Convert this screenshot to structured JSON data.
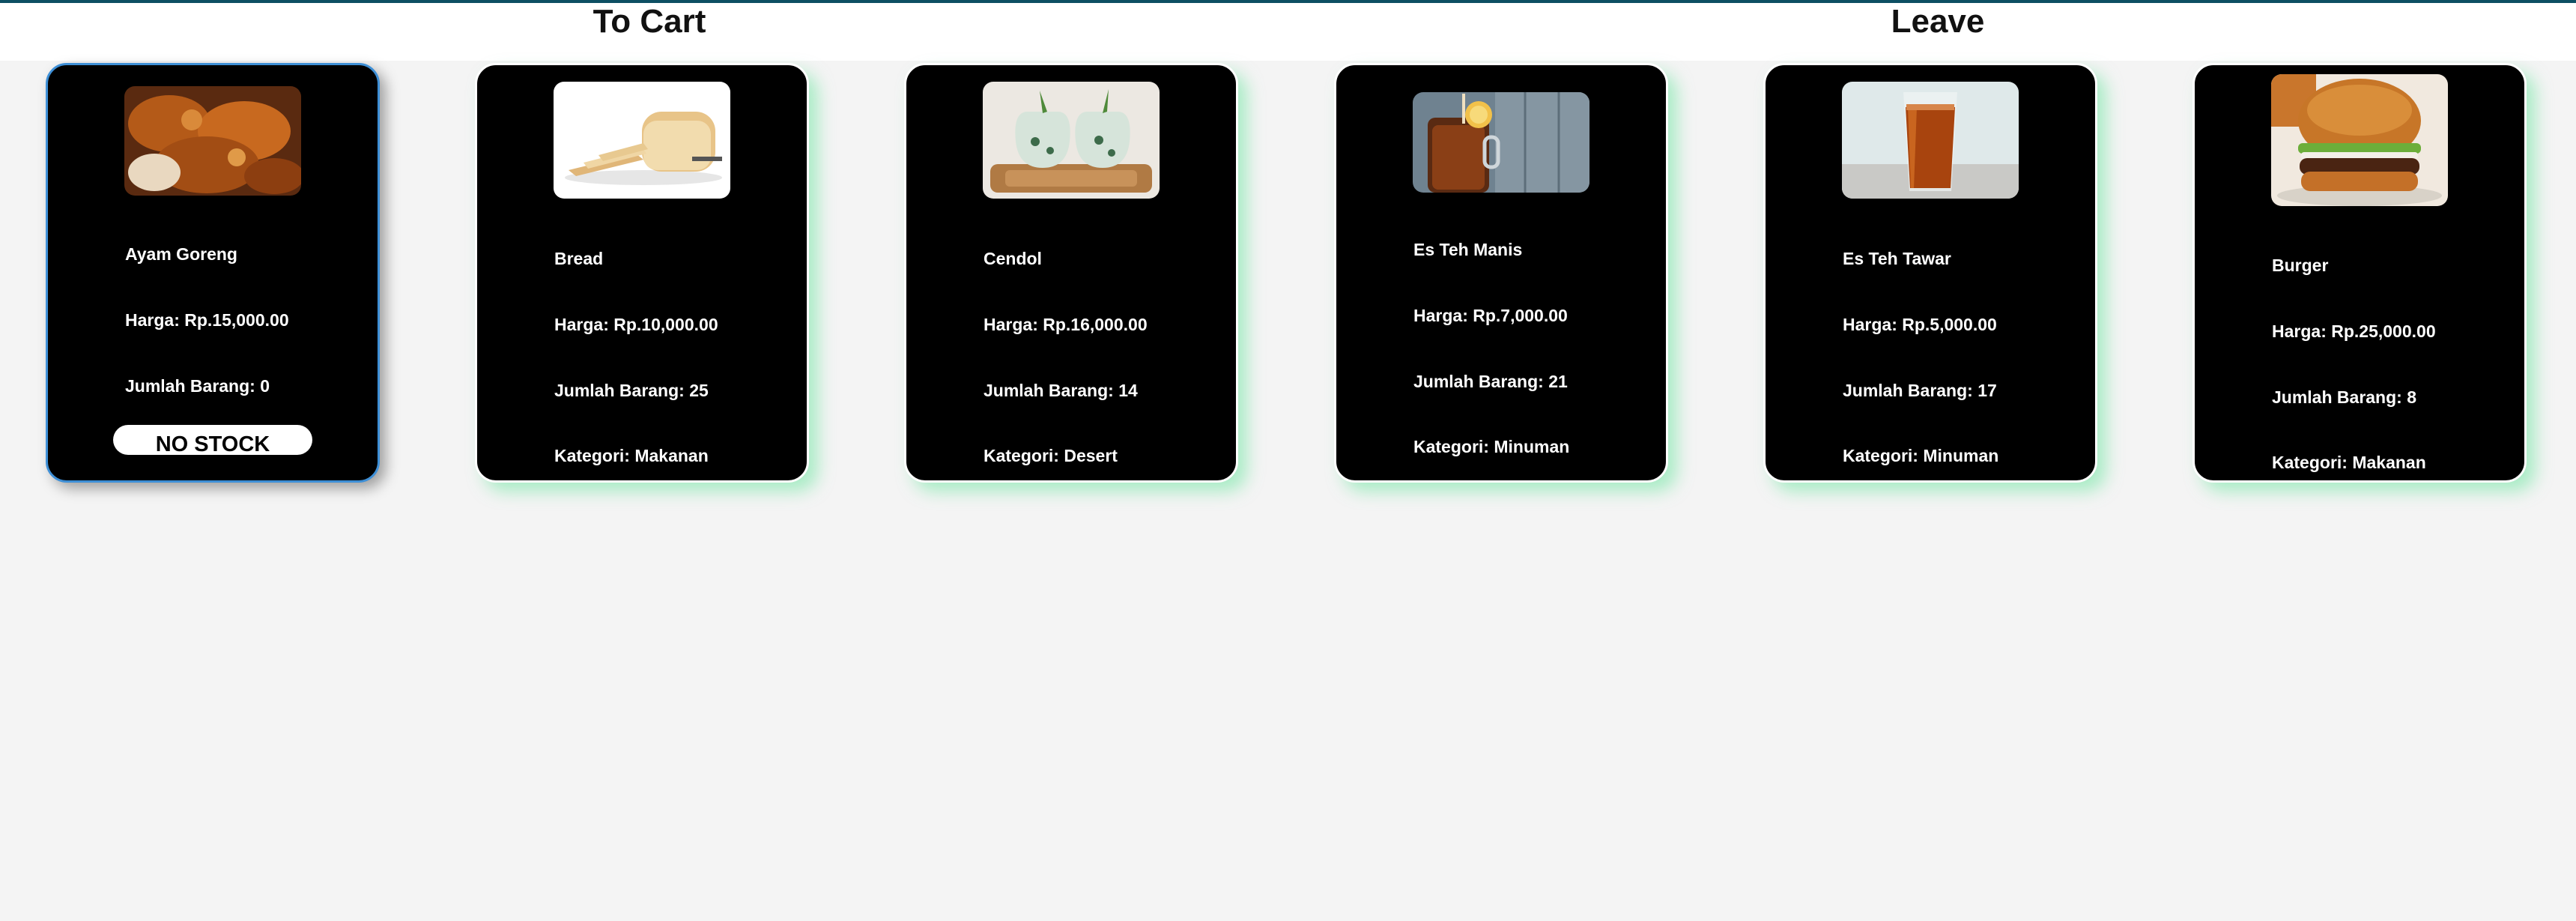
{
  "nav": {
    "to_cart": "To Cart",
    "leave": "Leave"
  },
  "products": [
    {
      "name": "Ayam Goreng",
      "price": "Harga: Rp.15,000.00",
      "stock": "Jumlah Barang: 0",
      "button": "NO STOCK",
      "image_icon": "fried-chicken-image"
    },
    {
      "name": "Bread",
      "price": "Harga: Rp.10,000.00",
      "stock": "Jumlah Barang: 25",
      "category": "Kategori: Makanan",
      "image_icon": "bread-image"
    },
    {
      "name": "Cendol",
      "price": "Harga: Rp.16,000.00",
      "stock": "Jumlah Barang: 14",
      "category": "Kategori: Desert",
      "image_icon": "cendol-image"
    },
    {
      "name": "Es Teh Manis",
      "price": "Harga: Rp.7,000.00",
      "stock": "Jumlah Barang: 21",
      "category": "Kategori: Minuman",
      "image_icon": "iced-tea-jar-image"
    },
    {
      "name": "Es Teh Tawar",
      "price": "Harga: Rp.5,000.00",
      "stock": "Jumlah Barang: 17",
      "category": "Kategori: Minuman",
      "image_icon": "iced-tea-glass-image"
    },
    {
      "name": "Burger",
      "price": "Harga: Rp.25,000.00",
      "stock": "Jumlah Barang: 8",
      "category": "Kategori: Makanan",
      "image_icon": "burger-image"
    }
  ],
  "colors": {
    "top_line": "#0d4f63",
    "card_background": "#000000",
    "card_glow": "#6ee6a0",
    "selected_border": "#3e8fd6",
    "page_background": "#f4f4f4"
  }
}
